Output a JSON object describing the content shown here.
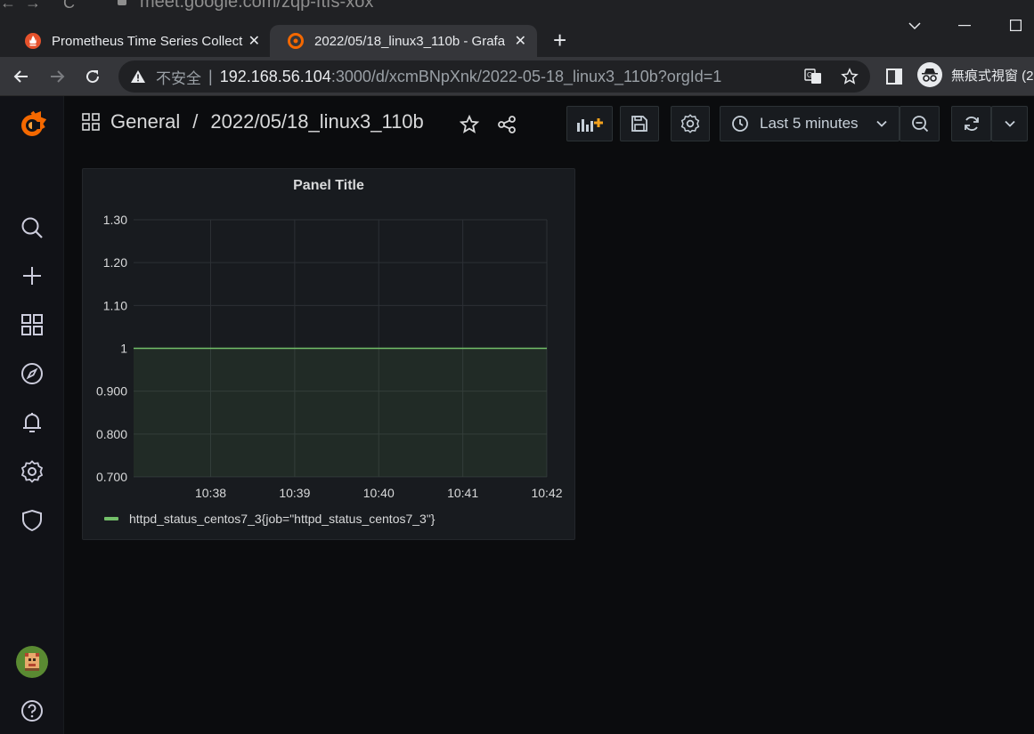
{
  "browser": {
    "previous_url": "meet.google.com/zqp-ftfs-xox",
    "tabs": [
      {
        "title": "Prometheus Time Series Collect",
        "close": "✕",
        "active": false
      },
      {
        "title": "2022/05/18_linux3_110b - Grafa",
        "close": "✕",
        "active": true
      }
    ],
    "new_tab": "+",
    "address": {
      "security_label": "不安全",
      "separator": "|",
      "host": "192.168.56.104",
      "rest": ":3000/d/xcmBNpXnk/2022-05-18_linux3_110b?orgId=1"
    },
    "incognito_label": "無痕式視窗 (2"
  },
  "grafana": {
    "breadcrumb": {
      "folder": "General",
      "separator": "/",
      "dashboard": "2022/05/18_linux3_110b"
    },
    "time_picker": {
      "label": "Last 5 minutes"
    },
    "sidebar_icons": [
      "grafana-logo-icon",
      "search-icon",
      "plus-icon",
      "dashboards-icon",
      "explore-icon",
      "alerting-icon",
      "configuration-icon",
      "shield-icon",
      "user-avatar",
      "help-icon"
    ],
    "colors": {
      "accent": "#f46800",
      "series": "#73bf69",
      "background": "#0b0c0e",
      "panel": "#181b1f"
    }
  },
  "panel": {
    "title": "Panel Title",
    "legend": "httpd_status_centos7_3{job=\"httpd_status_centos7_3\"}"
  },
  "chart_data": {
    "type": "area",
    "title": "Panel Title",
    "x_ticks": [
      "10:38",
      "10:39",
      "10:40",
      "10:41",
      "10:42"
    ],
    "y_ticks": [
      "0.700",
      "0.800",
      "0.900",
      "1",
      "1.10",
      "1.20",
      "1.30"
    ],
    "ylim": [
      0.7,
      1.3
    ],
    "xlim": [
      "10:37:05",
      "10:42:00"
    ],
    "grid": true,
    "legend_position": "bottom-left",
    "series": [
      {
        "name": "httpd_status_centos7_3{job=\"httpd_status_centos7_3\"}",
        "color": "#73bf69",
        "x": [
          "10:37:05",
          "10:42:00"
        ],
        "values": [
          1,
          1
        ]
      }
    ]
  }
}
